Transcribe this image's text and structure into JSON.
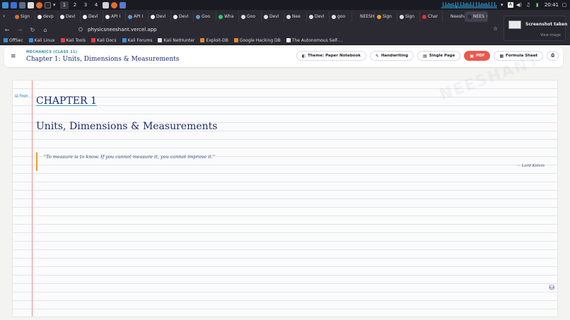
{
  "taskbar": {
    "workspaces": [
      "1",
      "2",
      "3",
      "4"
    ],
    "clock": "20:41"
  },
  "tabs": [
    {
      "label": "Sign",
      "color": "#e66a2a"
    },
    {
      "label": "devp",
      "color": "#eeeeee"
    },
    {
      "label": "Devl",
      "color": "#eeeeee"
    },
    {
      "label": "Devl",
      "color": "#eeeeee"
    },
    {
      "label": "API I",
      "color": "#eeeeee"
    },
    {
      "label": "API I",
      "color": "#5b9bd5"
    },
    {
      "label": "Devl",
      "color": "#eeeeee"
    },
    {
      "label": "Devl",
      "color": "#eeeeee"
    },
    {
      "label": "Goo",
      "color": "#5b9bd5"
    },
    {
      "label": "Wha",
      "color": "#25d366"
    },
    {
      "label": "Goo",
      "color": "#dddddd"
    },
    {
      "label": "Devl",
      "color": "#dddddd"
    },
    {
      "label": "Nee",
      "color": "#dddddd"
    },
    {
      "label": "Devl",
      "color": "#dddddd"
    },
    {
      "label": "goo",
      "color": "#dddddd"
    },
    {
      "label": "NEESH",
      "color": "#2b2a33"
    },
    {
      "label": "Sign",
      "color": "#f0a020"
    },
    {
      "label": "Sign",
      "color": "#dddddd"
    },
    {
      "label": "Char",
      "color": "#e03030"
    },
    {
      "label": "Neesha",
      "color": "#2b2a33"
    },
    {
      "label": "NEES",
      "color": "#2b2a33",
      "active": true
    }
  ],
  "browser": {
    "url": "physicsneeshant.vercel.app"
  },
  "bookmarks": [
    {
      "label": "OffSec",
      "color": "#3b8fd9"
    },
    {
      "label": "Kali Linux",
      "color": "#3b8fd9"
    },
    {
      "label": "Kali Tools",
      "color": "#e04040"
    },
    {
      "label": "Kali Docs",
      "color": "#e04040"
    },
    {
      "label": "Kali Forums",
      "color": "#3b8fd9"
    },
    {
      "label": "Kali NetHunter",
      "color": "#dddddd"
    },
    {
      "label": "Exploit-DB",
      "color": "#e08a30"
    },
    {
      "label": "Google Hacking DB",
      "color": "#e08a30"
    },
    {
      "label": "The Autonomous Self-...",
      "color": "#eeeeee"
    }
  ],
  "notification": {
    "title": "Screenshot taken",
    "action": "View image"
  },
  "header": {
    "kicker": "MECHANICS (CLASS 11)",
    "title": "Chapter 1: Units, Dimensions & Measurements",
    "actions": [
      {
        "label": "Theme: Paper Notebook",
        "icon": "palette-icon",
        "glyph": "◐"
      },
      {
        "label": "Handwriting",
        "icon": "pen-icon",
        "glyph": "✎"
      },
      {
        "label": "Single Page",
        "icon": "document-icon",
        "glyph": "▤"
      },
      {
        "label": "PDF",
        "icon": "pdf-icon",
        "glyph": "▣"
      },
      {
        "label": "Formula Sheet",
        "icon": "clipboard-icon",
        "glyph": "▦"
      }
    ]
  },
  "notebook": {
    "page_link": "Page",
    "chapter": "CHAPTER 1",
    "chapter_title": "Units, Dimensions & Measurements",
    "quote": "\"To measure is to know. If you cannot measure it, you cannot improve it.\"",
    "quote_author": "— Lord Kelvin"
  }
}
